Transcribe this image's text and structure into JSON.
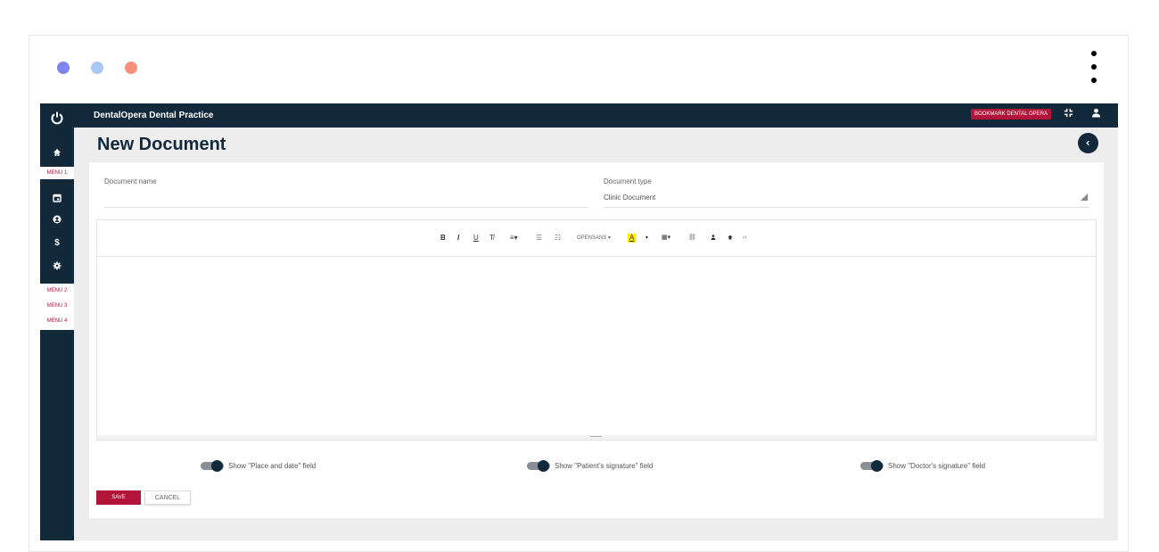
{
  "window": {
    "dots": [
      {
        "name": "window-dot-blue",
        "color": "#7b86f0"
      },
      {
        "name": "window-dot-lightblue",
        "color": "#a9c8f5"
      },
      {
        "name": "window-dot-orange",
        "color": "#f7907b"
      }
    ]
  },
  "topbar": {
    "app_title": "DentalOpera Dental Practice",
    "bookmark_label": "BOOKMARK DENTAL OPERA",
    "compress_icon": "compress-icon",
    "user_icon": "user-icon"
  },
  "sidebar": {
    "power_icon": "power-icon",
    "home_icon": "home-icon",
    "menu1": "MENU 1",
    "calendar_icon": "calendar-icon",
    "user_circle_icon": "user-circle-icon",
    "dollar_icon": "dollar-icon",
    "settings_icon": "gear-icon",
    "menu2": "MENU 2",
    "menu3": "MENU 3",
    "menu4": "MENU 4"
  },
  "page": {
    "title": "New Document"
  },
  "form": {
    "document_name_label": "Document name",
    "document_name_value": "",
    "document_type_label": "Document type",
    "document_type_value": "Clinic Document"
  },
  "toolbar": {
    "bold": "B",
    "italic": "I",
    "underline": "U",
    "clear_format": "T̸",
    "align": "≡▾",
    "unordered_list": "☰",
    "ordered_list": "☷",
    "font": "OPENSANS ▾",
    "highlight": "A",
    "highlight_caret": "▾",
    "table": "▦▾",
    "link": "⛓",
    "person": "👤",
    "home": "⌂",
    "code": "‹›"
  },
  "toggles": [
    {
      "label": "Show \"Place and date\" field",
      "on": true
    },
    {
      "label": "Show \"Patient's signature\" field",
      "on": true
    },
    {
      "label": "Show \"Doctor's signature\" field",
      "on": true
    }
  ],
  "buttons": {
    "save": "SAVE",
    "cancel": "CANCEL"
  },
  "colors": {
    "navy": "#11293b",
    "accent": "#b3143a",
    "highlight": "#ffeb00"
  }
}
